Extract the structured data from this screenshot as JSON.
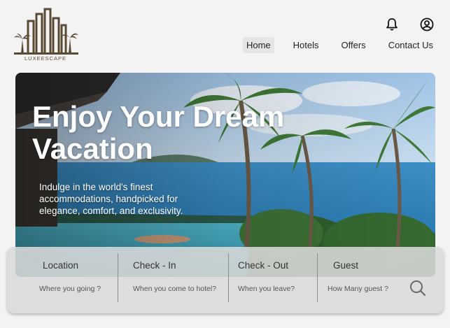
{
  "brand": {
    "name": "LUXEESCAPE"
  },
  "header": {
    "icons": [
      "bell-icon",
      "user-account-icon"
    ],
    "nav": [
      {
        "label": "Home",
        "active": true
      },
      {
        "label": "Hotels",
        "active": false
      },
      {
        "label": "Offers",
        "active": false
      },
      {
        "label": "Contact Us",
        "active": false
      }
    ]
  },
  "hero": {
    "title_line1": "Enjoy Your Dream",
    "title_line2": "Vacation",
    "subtitle": "Indulge in the world's finest accommodations, handpicked for elegance, comfort, and exclusivity."
  },
  "search": {
    "fields": [
      {
        "label": "Location",
        "placeholder": "Where you going ?"
      },
      {
        "label": "Check - In",
        "placeholder": "When you come to hotel?"
      },
      {
        "label": "Check - Out",
        "placeholder": "When you leave?"
      },
      {
        "label": "Guest",
        "placeholder": "How Many guest ?"
      }
    ],
    "button_icon": "search-icon"
  },
  "colors": {
    "brand": "#5a4a34",
    "nav_active_bg": "#e5e5e5",
    "search_bar_bg": "#dadada",
    "sea": "#2f7fb8"
  }
}
